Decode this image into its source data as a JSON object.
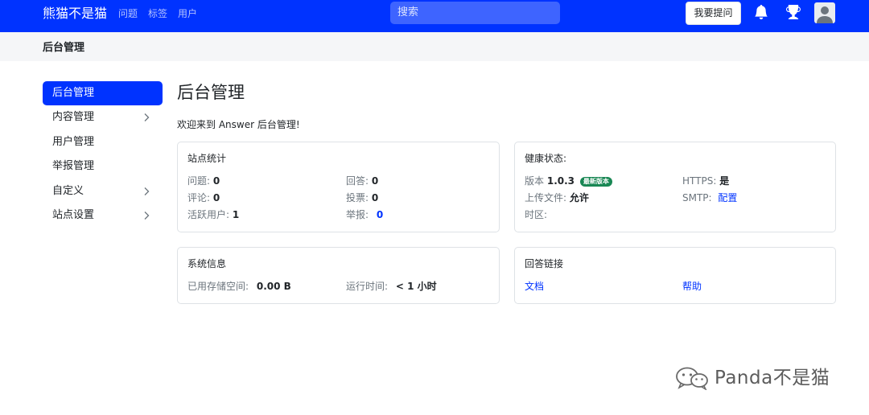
{
  "navbar": {
    "brand": "熊猫不是猫",
    "links": [
      "问题",
      "标签",
      "用户"
    ],
    "search_placeholder": "搜索",
    "ask_button": "我要提问",
    "icons": [
      "bell-icon",
      "trophy-icon",
      "user-avatar-icon"
    ],
    "color": "#0033ff"
  },
  "subheader": {
    "title": "后台管理"
  },
  "sidebar": {
    "items": [
      {
        "label": "后台管理",
        "active": true
      },
      {
        "label": "内容管理",
        "expandable": true
      },
      {
        "label": "用户管理"
      },
      {
        "label": "举报管理"
      },
      {
        "label": "自定义",
        "expandable": true
      },
      {
        "label": "站点设置",
        "expandable": true
      }
    ]
  },
  "main": {
    "title": "后台管理",
    "welcome": "欢迎来到 Answer 后台管理!",
    "site_stats": {
      "title": "站点统计",
      "questions_label": "问题:",
      "questions_value": "0",
      "answers_label": "回答:",
      "answers_value": "0",
      "comments_label": "评论:",
      "comments_value": "0",
      "votes_label": "投票:",
      "votes_value": "0",
      "active_users_label": "活跃用户:",
      "active_users_value": "1",
      "reports_label": "举报:",
      "reports_value": "0"
    },
    "health": {
      "title": "健康状态:",
      "version_label": "版本",
      "version_value": "1.0.3",
      "version_badge": "最新版本",
      "https_label": "HTTPS:",
      "https_value": "是",
      "upload_label": "上传文件:",
      "upload_value": "允许",
      "smtp_label": "SMTP:",
      "smtp_link": "配置",
      "timezone_label": "时区:"
    },
    "system_info": {
      "title": "系统信息",
      "storage_label": "已用存储空间:",
      "storage_value": "0.00 B",
      "uptime_label": "运行时间:",
      "uptime_value": "< 1 小时"
    },
    "answer_links": {
      "title": "回答链接",
      "docs": "文档",
      "help": "帮助"
    }
  },
  "watermark": {
    "text": "Panda不是猫"
  }
}
